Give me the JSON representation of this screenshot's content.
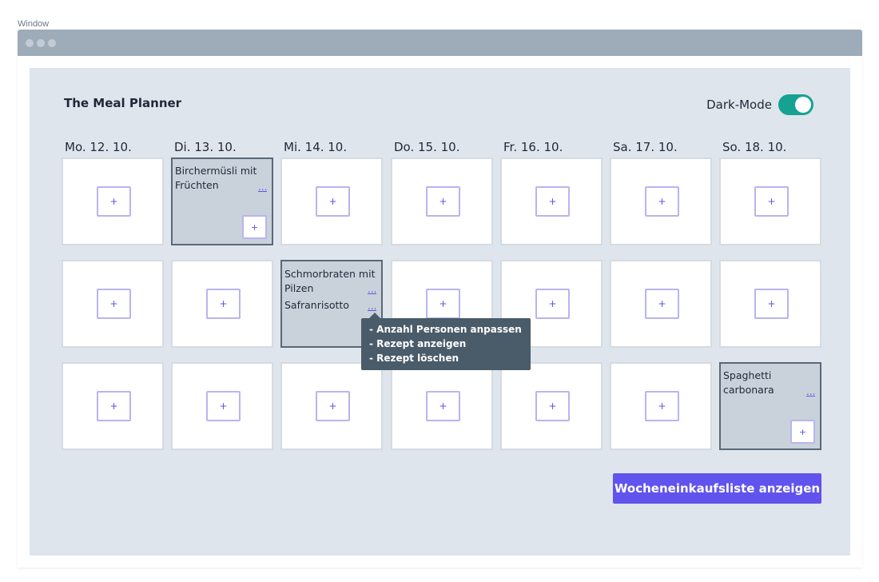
{
  "window": {
    "label": "Window"
  },
  "app": {
    "title": "The Meal Planner",
    "dark_mode_label": "Dark-Mode",
    "dark_mode_on": true
  },
  "days": [
    "Mo. 12. 10.",
    "Di. 13. 10.",
    "Mi. 14. 10.",
    "Do. 15. 10.",
    "Fr. 16. 10.",
    "Sa. 17. 10.",
    "So. 18. 10."
  ],
  "add_label": "+",
  "more_label": "...",
  "meals": {
    "tue_row1": {
      "line1": "Birchermüsli mit",
      "line2": "Früchten"
    },
    "wed_row2": {
      "line1": "Schmorbraten mit",
      "line2": "Pilzen",
      "line3": "Safranrisotto"
    },
    "sun_row3": {
      "line1": "Spaghetti",
      "line2": "carbonara"
    }
  },
  "context_menu": [
    "- Anzahl Personen anpassen",
    "- Rezept anzeigen",
    "- Rezept löschen"
  ],
  "shopping_button": "Wocheneinkaufsliste anzeigen",
  "colors": {
    "accent": "#6153ee",
    "toggle": "#16a292",
    "tooltip": "#4a5b69",
    "panel": "#dfe5ec"
  }
}
